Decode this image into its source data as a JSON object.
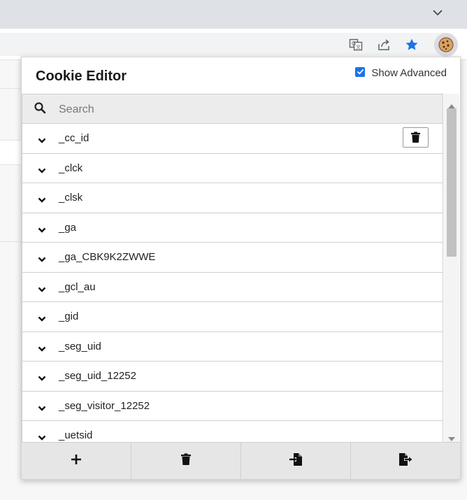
{
  "popup": {
    "title": "Cookie Editor",
    "show_advanced_label": "Show Advanced",
    "show_advanced_checked": true
  },
  "search": {
    "placeholder": "Search"
  },
  "cookies": [
    "_cc_id",
    "_clck",
    "_clsk",
    "_ga",
    "_ga_CBK9K2ZWWE",
    "_gcl_au",
    "_gid",
    "_seg_uid",
    "_seg_uid_12252",
    "_seg_visitor_12252",
    "_uetsid"
  ],
  "footer": {
    "buttons": [
      "add-cookie",
      "delete-all",
      "import",
      "export"
    ]
  },
  "colors": {
    "accent": "#1a73e8",
    "star": "#1a73e8"
  }
}
